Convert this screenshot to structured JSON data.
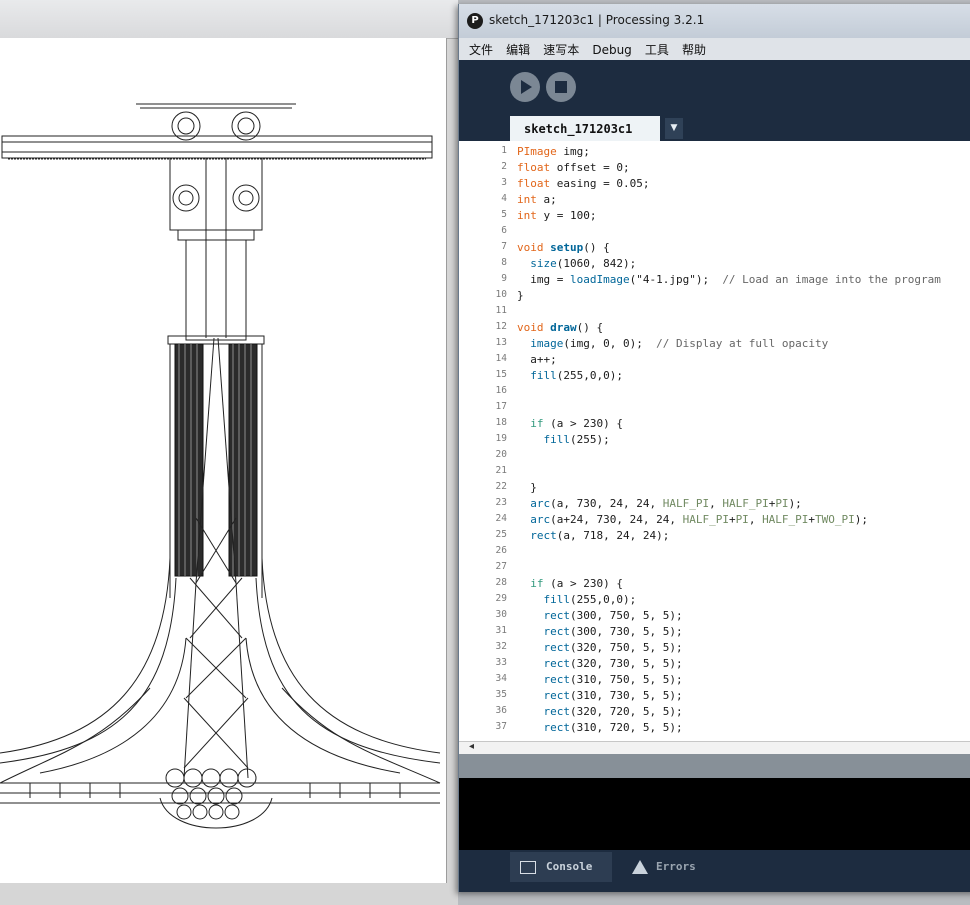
{
  "editor": {
    "window_title": "sketch_171203c1 | Processing 3.2.1",
    "menu": [
      "文件",
      "编辑",
      "速写本",
      "Debug",
      "工具",
      "帮助"
    ],
    "tab_label": "sketch_171203c1",
    "tab_menu_icon": "▼",
    "run_icon": "play-icon",
    "stop_icon": "stop-icon",
    "footer": {
      "console_label": "Console",
      "errors_label": "Errors"
    },
    "colors": {
      "keyword": "#33997e",
      "type": "#e2661a",
      "function": "#006699",
      "comment": "#666666",
      "constant": "#718a62"
    },
    "code_lines": [
      {
        "n": "1",
        "text": "PImage img;"
      },
      {
        "n": "2",
        "text": "float offset = 0;"
      },
      {
        "n": "3",
        "text": "float easing = 0.05;"
      },
      {
        "n": "4",
        "text": "int a;"
      },
      {
        "n": "5",
        "text": "int y = 100;"
      },
      {
        "n": "6",
        "text": ""
      },
      {
        "n": "7",
        "text": "void setup() {"
      },
      {
        "n": "8",
        "text": "  size(1060, 842);"
      },
      {
        "n": "9",
        "text": "  img = loadImage(\"4-1.jpg\");  // Load an image into the program"
      },
      {
        "n": "10",
        "text": "}"
      },
      {
        "n": "11",
        "text": ""
      },
      {
        "n": "12",
        "text": "void draw() {"
      },
      {
        "n": "13",
        "text": "  image(img, 0, 0);  // Display at full opacity"
      },
      {
        "n": "14",
        "text": "  a++;"
      },
      {
        "n": "15",
        "text": "  fill(255,0,0);"
      },
      {
        "n": "16",
        "text": ""
      },
      {
        "n": "17",
        "text": ""
      },
      {
        "n": "18",
        "text": "  if (a > 230) {"
      },
      {
        "n": "19",
        "text": "    fill(255);"
      },
      {
        "n": "20",
        "text": ""
      },
      {
        "n": "21",
        "text": ""
      },
      {
        "n": "22",
        "text": "  }"
      },
      {
        "n": "23",
        "text": "  arc(a, 730, 24, 24, HALF_PI, HALF_PI+PI);"
      },
      {
        "n": "24",
        "text": "  arc(a+24, 730, 24, 24, HALF_PI+PI, HALF_PI+TWO_PI);"
      },
      {
        "n": "25",
        "text": "  rect(a, 718, 24, 24);"
      },
      {
        "n": "26",
        "text": ""
      },
      {
        "n": "27",
        "text": ""
      },
      {
        "n": "28",
        "text": "  if (a > 230) {"
      },
      {
        "n": "29",
        "text": "    fill(255,0,0);"
      },
      {
        "n": "30",
        "text": "    rect(300, 750, 5, 5);"
      },
      {
        "n": "31",
        "text": "    rect(300, 730, 5, 5);"
      },
      {
        "n": "32",
        "text": "    rect(320, 750, 5, 5);"
      },
      {
        "n": "33",
        "text": "    rect(320, 730, 5, 5);"
      },
      {
        "n": "34",
        "text": "    rect(310, 750, 5, 5);"
      },
      {
        "n": "35",
        "text": "    rect(310, 730, 5, 5);"
      },
      {
        "n": "36",
        "text": "    rect(320, 720, 5, 5);"
      },
      {
        "n": "37",
        "text": "    rect(310, 720, 5, 5);"
      }
    ]
  }
}
